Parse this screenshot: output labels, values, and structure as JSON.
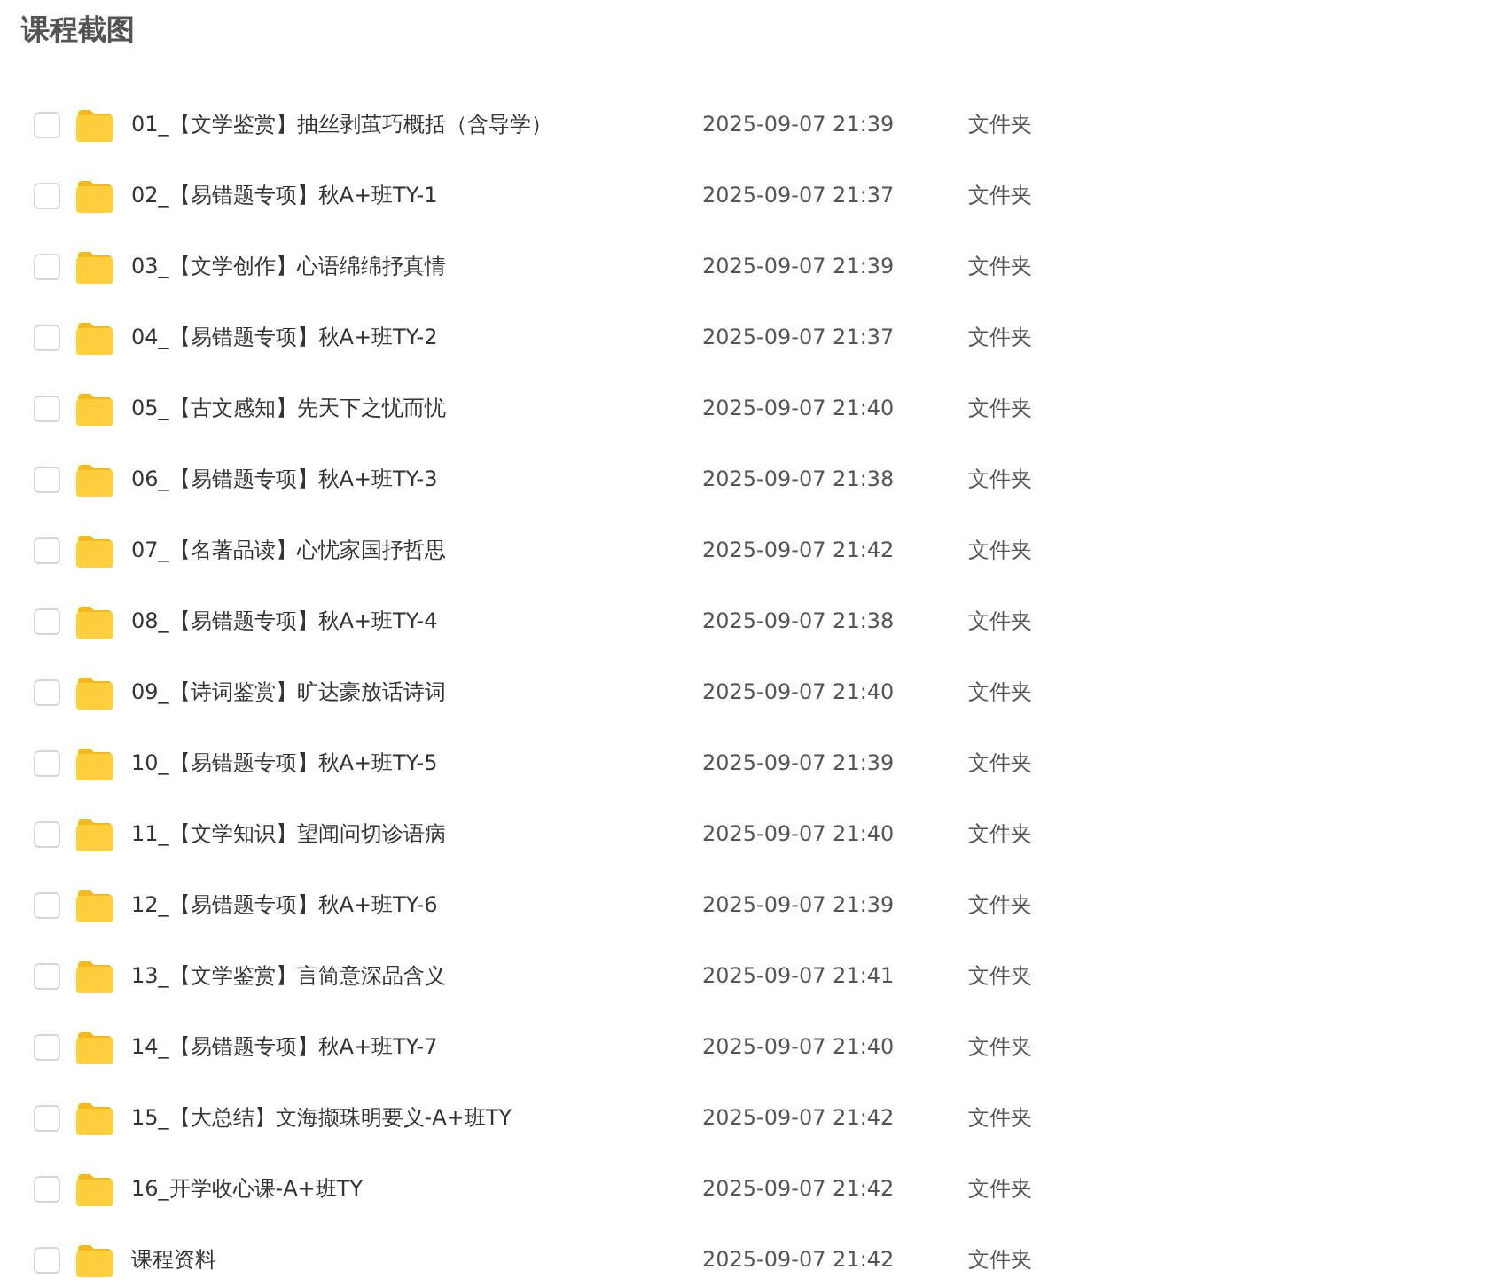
{
  "title": "课程截图",
  "files": [
    {
      "name": "01_【文学鉴赏】抽丝剥茧巧概括（含导学）",
      "modified": "2025-09-07 21:39",
      "type": "文件夹",
      "checked": false
    },
    {
      "name": "02_【易错题专项】秋A+班TY-1",
      "modified": "2025-09-07 21:37",
      "type": "文件夹",
      "checked": false
    },
    {
      "name": "03_【文学创作】心语绵绵抒真情",
      "modified": "2025-09-07 21:39",
      "type": "文件夹",
      "checked": false
    },
    {
      "name": "04_【易错题专项】秋A+班TY-2",
      "modified": "2025-09-07 21:37",
      "type": "文件夹",
      "checked": false
    },
    {
      "name": "05_【古文感知】先天下之忧而忧",
      "modified": "2025-09-07 21:40",
      "type": "文件夹",
      "checked": false
    },
    {
      "name": "06_【易错题专项】秋A+班TY-3",
      "modified": "2025-09-07 21:38",
      "type": "文件夹",
      "checked": false
    },
    {
      "name": "07_【名著品读】心忧家国抒哲思",
      "modified": "2025-09-07 21:42",
      "type": "文件夹",
      "checked": false
    },
    {
      "name": "08_【易错题专项】秋A+班TY-4",
      "modified": "2025-09-07 21:38",
      "type": "文件夹",
      "checked": false
    },
    {
      "name": "09_【诗词鉴赏】旷达豪放话诗词",
      "modified": "2025-09-07 21:40",
      "type": "文件夹",
      "checked": false
    },
    {
      "name": "10_【易错题专项】秋A+班TY-5",
      "modified": "2025-09-07 21:39",
      "type": "文件夹",
      "checked": false
    },
    {
      "name": "11_【文学知识】望闻问切诊语病",
      "modified": "2025-09-07 21:40",
      "type": "文件夹",
      "checked": false
    },
    {
      "name": "12_【易错题专项】秋A+班TY-6",
      "modified": "2025-09-07 21:39",
      "type": "文件夹",
      "checked": false
    },
    {
      "name": "13_【文学鉴赏】言简意深品含义",
      "modified": "2025-09-07 21:41",
      "type": "文件夹",
      "checked": false
    },
    {
      "name": "14_【易错题专项】秋A+班TY-7",
      "modified": "2025-09-07 21:40",
      "type": "文件夹",
      "checked": false
    },
    {
      "name": "15_【大总结】文海撷珠明要义-A+班TY",
      "modified": "2025-09-07 21:42",
      "type": "文件夹",
      "checked": false
    },
    {
      "name": "16_开学收心课-A+班TY",
      "modified": "2025-09-07 21:42",
      "type": "文件夹",
      "checked": false
    },
    {
      "name": "课程资料",
      "modified": "2025-09-07 21:42",
      "type": "文件夹",
      "checked": false
    }
  ]
}
